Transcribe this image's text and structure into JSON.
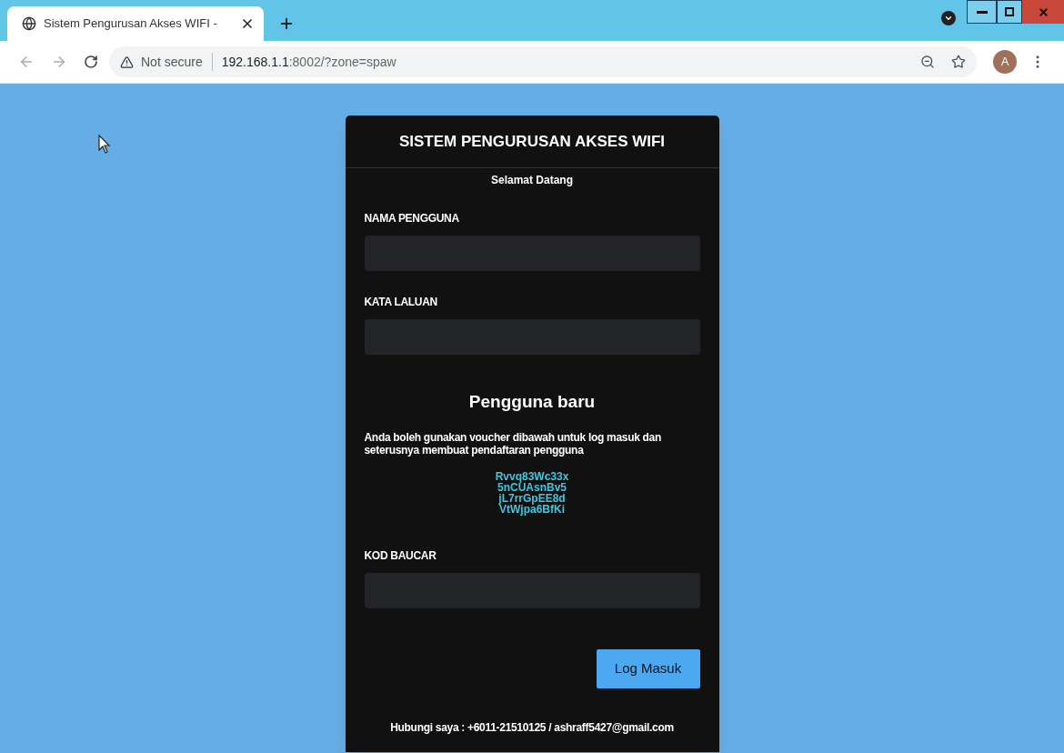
{
  "browser": {
    "tab_title": "Sistem Pengurusan Akses WIFI -",
    "security": "Not secure",
    "url_host": "192.168.1.1",
    "url_rest": ":8002/?zone=spaw",
    "profile_initial": "A"
  },
  "card": {
    "title": "SISTEM PENGURUSAN AKSES WIFI",
    "subtitle": "Selamat Datang",
    "fields": [
      {
        "label": "NAMA PENGGUNA"
      },
      {
        "label": "KATA LALUAN"
      }
    ],
    "new_user": {
      "heading": "Pengguna baru",
      "text": "Anda boleh gunakan voucher dibawah untuk log masuk dan seterusnya membuat pendaftaran pengguna",
      "vouchers": [
        "Rvvq83Wc33x",
        "5nCUAsnBv5",
        "jL7rrGpEE8d",
        "VtWjpa6BfKi"
      ]
    },
    "voucher_field": {
      "label": "KOD BAUCAR"
    },
    "button": "Log Masuk",
    "contact": "Hubungi saya : +6011-21510125 / ashraff5427@gmail.com"
  }
}
